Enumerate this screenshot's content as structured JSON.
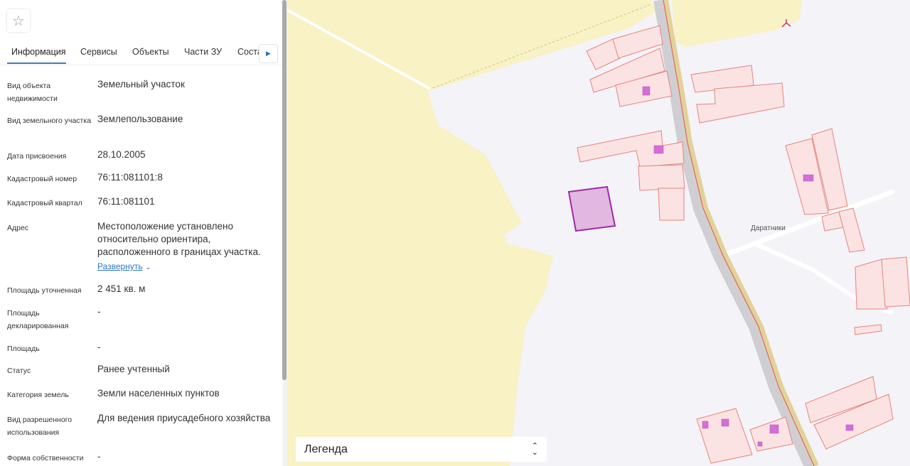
{
  "panel": {
    "favorite_icon": "star-icon",
    "tabs": [
      {
        "label": "Информация",
        "active": true
      },
      {
        "label": "Сервисы"
      },
      {
        "label": "Объекты"
      },
      {
        "label": "Части ЗУ"
      },
      {
        "label": "Соста"
      }
    ],
    "tabs_next_icon": "caret-right-icon",
    "accent_color": "#3d7fc4",
    "fields": [
      {
        "label": "Вид объекта недвижимости",
        "value": "Земельный участок"
      },
      {
        "label": "Вид земельного участка",
        "value": "Землепользование"
      },
      {
        "label": "Дата присвоения",
        "value": "28.10.2005"
      },
      {
        "label": "Кадастровый номер",
        "value": "76:11:081101:8"
      },
      {
        "label": "Кадастровый квартал",
        "value": "76:11:081101"
      },
      {
        "label": "Адрес",
        "value": "Местоположение установлено относительно ориентира, расположенного в границах участка.",
        "expand_label": "Развернуть"
      },
      {
        "label": "Площадь уточненная",
        "value": "2 451 кв. м"
      },
      {
        "label": "Площадь декларированная",
        "value": "-"
      },
      {
        "label": "Площадь",
        "value": "-"
      },
      {
        "label": "Статус",
        "value": "Ранее учтенный"
      },
      {
        "label": "Категория земель",
        "value": "Земли населенных пунктов"
      },
      {
        "label": "Вид разрешенного использования",
        "value": "Для ведения приусадебного хозяйства"
      },
      {
        "label": "Форма собственности",
        "value": "-"
      }
    ]
  },
  "map": {
    "place_label": "Даратники",
    "legend_label": "Легенда",
    "legend_icon": "chevron-up-down-icon",
    "colors": {
      "background": "#f3f3f8",
      "zone_yellow": "#f8f2c4",
      "parcel_fill": "#fbe3e3",
      "parcel_stroke": "#e8837d",
      "selected_parcel": "#a02aa8",
      "building": "#d56fd8",
      "road": "#cfcfd3"
    }
  }
}
